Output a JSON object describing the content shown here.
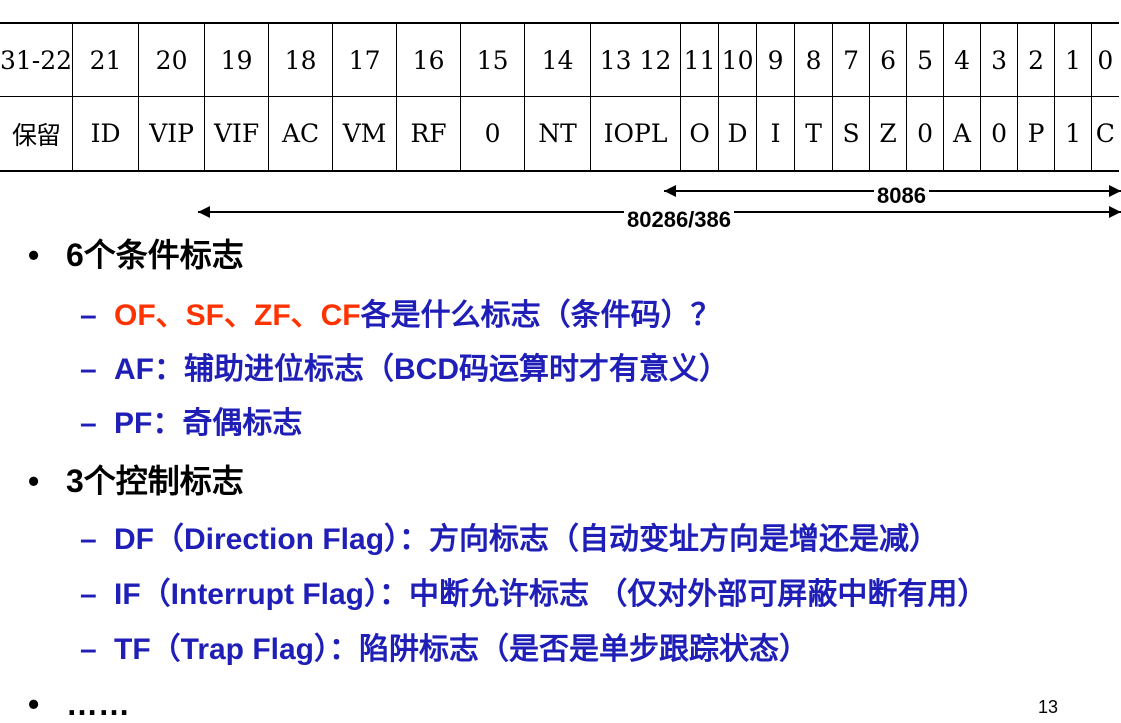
{
  "table": {
    "header": [
      "31-22",
      "21",
      "20",
      "19",
      "18",
      "17",
      "16",
      "15",
      "14",
      "13 12",
      "11",
      "10",
      "9",
      "8",
      "7",
      "6",
      "5",
      "4",
      "3",
      "2",
      "1",
      "0"
    ],
    "flags": [
      "保留",
      "ID",
      "VIP",
      "VIF",
      "AC",
      "VM",
      "RF",
      "0",
      "NT",
      "IOPL",
      "O",
      "D",
      "I",
      "T",
      "S",
      "Z",
      "0",
      "A",
      "0",
      "P",
      "1",
      "C"
    ]
  },
  "ranges": {
    "r8086": "8086",
    "r80286": "80286/386"
  },
  "section1": {
    "title": "6个条件标志",
    "item1_red": "OF、SF、ZF、CF",
    "item1_rest": "各是什么标志（条件码）？",
    "item2": "AF：辅助进位标志（BCD码运算时才有意义）",
    "item3": "PF：奇偶标志"
  },
  "section2": {
    "title": "3个控制标志",
    "item1": "DF（Direction Flag）：方向标志（自动变址方向是增还是减）",
    "item2": "IF（Interrupt Flag）：中断允许标志 （仅对外部可屏蔽中断有用）",
    "item3": "TF（Trap Flag）：陷阱标志（是否是单步跟踪状态）"
  },
  "section3": {
    "title": "……"
  },
  "bullet_symbol": "•",
  "dash_symbol": "–",
  "page_number": "13",
  "colors": {
    "highlight": "#ff3300",
    "body_blue": "#1f1fb8",
    "text": "#000000"
  }
}
